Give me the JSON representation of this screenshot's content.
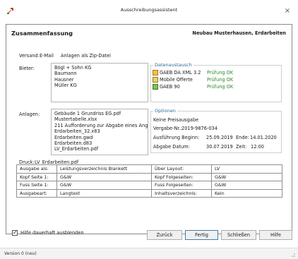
{
  "window": {
    "title": "Ausschreibungsassistent",
    "close_glyph": "×"
  },
  "summary": {
    "heading": "Zusammenfassung",
    "project": "Neubau Musterhausen, Erdarbeiten",
    "versand_label": "Versand:",
    "versand_value": "E-Mail",
    "versand_extra": "Anlagen als Zip-Datei",
    "bieter_label": "Bieter:",
    "bieter": [
      "Bögl + Sohn KG",
      "Baumann",
      "Hausner",
      "Müller KG"
    ],
    "anlagen_label": "Anlagen:",
    "anlagen": [
      "Gebäude 1 Grundriss EG.pdf",
      "Mustertabelle.xlsx",
      "211 Aufforderung zur Abgabe eines Ang",
      "Erdarbeiten_32.x83",
      "Erdarbeiten.gwd",
      "Erdarbeiten.d83",
      "LV_Erdarbeiten.pdf"
    ]
  },
  "datenaustausch": {
    "title": "Datenaustausch",
    "items": [
      {
        "icon": "gaeb-xml-icon",
        "name": "GAEB DA XML 3.2",
        "status": "Prüfung OK"
      },
      {
        "icon": "mobile-offerte-icon",
        "name": "Mobile Offerte",
        "status": "Prüfung OK"
      },
      {
        "icon": "gaeb-90-icon",
        "name": "GAEB 90",
        "status": "Prüfung OK"
      }
    ]
  },
  "optionen": {
    "title": "Optionen",
    "preisangabe": "Keine Preisausgabe",
    "vergabe_label": "Vergabe-Nr.:",
    "vergabe_value": "2019-9876-034",
    "ausfuehrung_label": "Ausführung Beginn:",
    "ausfuehrung_begin": "25.09.2019",
    "ende_label": "Ende:",
    "ende_value": "14.01.2020",
    "abgabe_label": "Abgabe Datum:",
    "abgabe_value": "30.07.2019",
    "zeit_label": "Zeit:",
    "zeit_value": "12:00"
  },
  "druck": {
    "label": "Druck:",
    "file": "LV_Erdarbeiten.pdf",
    "rows": [
      [
        "Ausgabe als:",
        "Leistungsverzeichnis Blankett",
        "Über Layout:",
        "LV"
      ],
      [
        "Kopf Seite 1:",
        "G&W",
        "Kopf Folgeseiten:",
        "G&W"
      ],
      [
        "Fuss Seite 1:",
        "G&W",
        "Fuss Folgeseiten:",
        "G&W"
      ],
      [
        "Ausgabeart:",
        "Langtext",
        "Inhaltsverzeichnis:",
        "Kein"
      ]
    ]
  },
  "footer": {
    "checkbox_label": "Hilfe dauerhaft ausblenden",
    "checkbox_mark": "✓",
    "btn_back": "Zurück",
    "btn_finish": "Fertig",
    "btn_close": "Schließen",
    "btn_help": "Hilfe"
  },
  "status": {
    "version": "Version 0 (neu)"
  },
  "colors": {
    "accent_title": "#2a6a9a",
    "ok_green": "#2e8b2e",
    "primary_border": "#3c7fb1"
  }
}
